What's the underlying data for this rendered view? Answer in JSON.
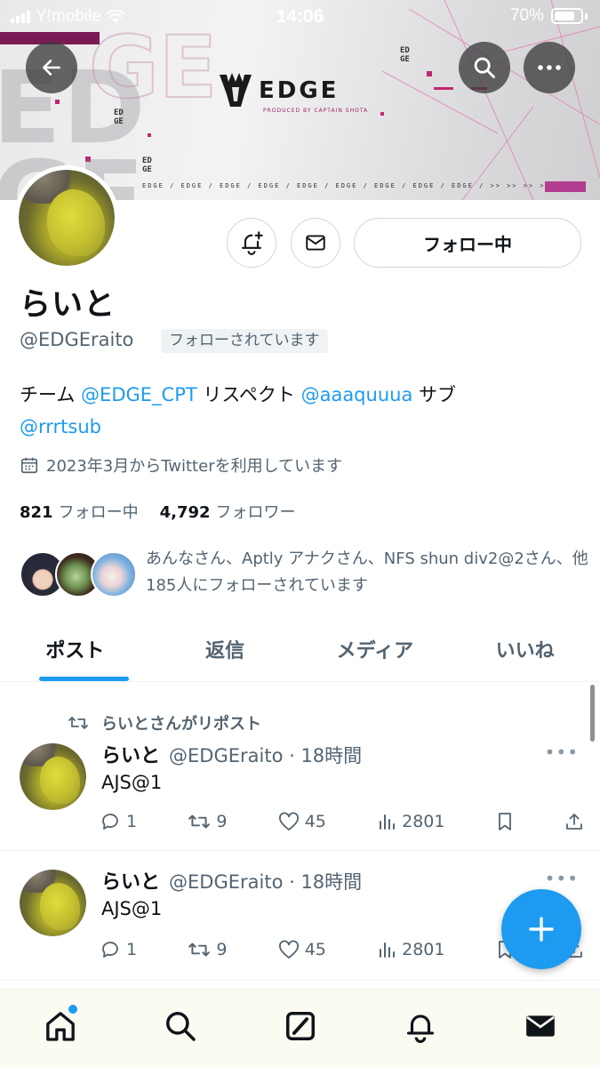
{
  "status_bar": {
    "carrier": "Y!mobile",
    "time": "14:06",
    "battery": "70%"
  },
  "banner": {
    "logo_text": "EDGE",
    "logo_sub": "PRODUCED BY CAPTAIN SHOTA",
    "strip_text": "EDGE / EDGE / EDGE / EDGE / EDGE / EDGE / EDGE / EDGE / EDGE /      >> >> >> >>",
    "big_letters": "ED\nGE",
    "ghost_letters": "GE",
    "mini_tag": "ED\nGE"
  },
  "profile": {
    "display_name": "らいと",
    "handle": "@EDGEraito",
    "follows_you": "フォローされています",
    "follow_button": "フォロー中",
    "bio": {
      "part1": "チーム ",
      "mention1": "@EDGE_CPT",
      "part2": " リスペクト ",
      "mention2": "@aaaquuua",
      "part3": " サブ ",
      "mention3": "@rrrtsub"
    },
    "joined": "2023年3月からTwitterを利用しています",
    "following_count": "821",
    "following_label": "フォロー中",
    "followers_count": "4,792",
    "followers_label": "フォロワー",
    "known_followers": "あんなさん、Aptly アナクさん、NFS shun div2@2さん、他185人にフォローされています"
  },
  "tabs": [
    {
      "label": "ポスト",
      "active": true
    },
    {
      "label": "返信",
      "active": false
    },
    {
      "label": "メディア",
      "active": false
    },
    {
      "label": "いいね",
      "active": false
    }
  ],
  "posts": [
    {
      "repost_label": "らいとさんがリポスト",
      "name": "らいと",
      "meta": "@EDGEraito · 18時間",
      "text": "AJS@1",
      "replies": "1",
      "reposts": "9",
      "likes": "45",
      "views": "2801"
    },
    {
      "name": "らいと",
      "meta": "@EDGEraito · 18時間",
      "text": "AJS@1",
      "replies": "1",
      "reposts": "9",
      "likes": "45",
      "views": "2801"
    }
  ],
  "bottom_nav": [
    "home-icon",
    "search-icon",
    "grok-icon",
    "bell-icon",
    "mail-icon"
  ],
  "colors": {
    "accent": "#1d9bf0",
    "text": "#0f1419",
    "secondary": "#536471"
  }
}
